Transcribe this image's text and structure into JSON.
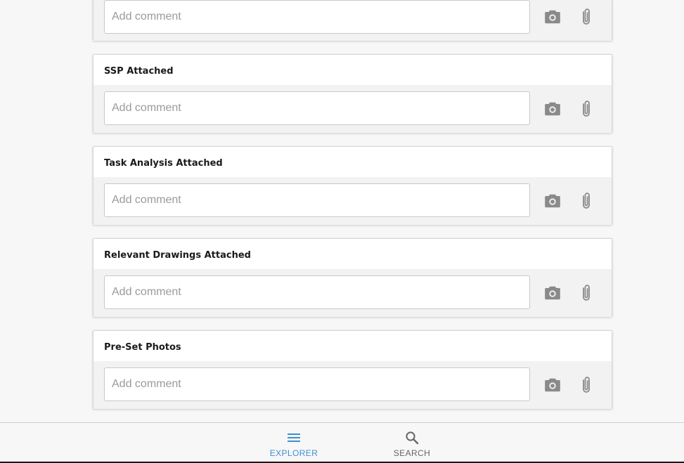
{
  "colors": {
    "accent": "#3d8fd6",
    "inactive": "#666666",
    "icon_gray": "#8a8a8a"
  },
  "cards": [
    {
      "title": "",
      "comment_placeholder": "Add comment",
      "comment_value": "",
      "camera_icon": "camera-icon",
      "attach_icon": "paperclip-icon"
    },
    {
      "title": "SSP Attached",
      "comment_placeholder": "Add comment",
      "comment_value": "",
      "camera_icon": "camera-icon",
      "attach_icon": "paperclip-icon"
    },
    {
      "title": "Task Analysis Attached",
      "comment_placeholder": "Add comment",
      "comment_value": "",
      "camera_icon": "camera-icon",
      "attach_icon": "paperclip-icon"
    },
    {
      "title": "Relevant Drawings Attached",
      "comment_placeholder": "Add comment",
      "comment_value": "",
      "camera_icon": "camera-icon",
      "attach_icon": "paperclip-icon"
    },
    {
      "title": "Pre-Set Photos",
      "comment_placeholder": "Add comment",
      "comment_value": "",
      "camera_icon": "camera-icon",
      "attach_icon": "paperclip-icon"
    }
  ],
  "bottom_nav": {
    "items": [
      {
        "label": "EXPLORER",
        "icon": "menu-icon",
        "active": true
      },
      {
        "label": "SEARCH",
        "icon": "search-icon",
        "active": false
      }
    ]
  }
}
